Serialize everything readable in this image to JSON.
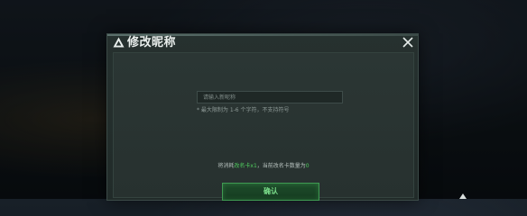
{
  "dialog": {
    "title": "修改昵称",
    "icon": "warning-triangle-icon",
    "close_icon": "close-icon"
  },
  "form": {
    "nickname_placeholder": "请输入新昵称",
    "nickname_value": "",
    "hint": "* 最大限制为 1-6 个字符，不支持符号"
  },
  "cost": {
    "prefix": "将消耗",
    "item": "改名卡x1",
    "middle": "，当前改名卡数量为",
    "count": "0"
  },
  "actions": {
    "confirm_label": "确认"
  },
  "colors": {
    "accent_green": "#4fcb5e",
    "dialog_bg": "#26312f",
    "title_text": "#e9eeec"
  }
}
